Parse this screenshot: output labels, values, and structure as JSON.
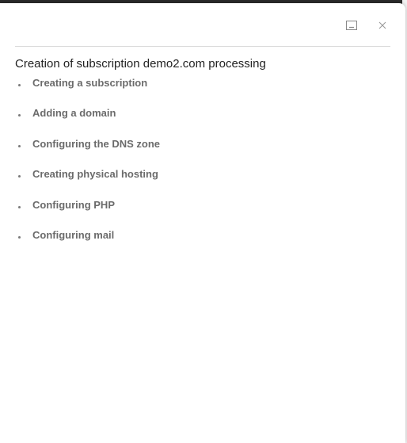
{
  "dialog": {
    "title": "Creation of subscription demo2.com processing",
    "minimize_icon": "minimize-icon",
    "close_icon": "close-icon"
  },
  "steps": [
    {
      "label": "Creating a subscription"
    },
    {
      "label": "Adding a domain"
    },
    {
      "label": "Configuring the DNS zone"
    },
    {
      "label": "Creating physical hosting"
    },
    {
      "label": "Configuring PHP"
    },
    {
      "label": "Configuring mail"
    }
  ],
  "colors": {
    "backdrop": "#2b2b2b",
    "title_text": "#222222",
    "step_text": "#6b6b6b",
    "divider": "#d9d9d9"
  }
}
